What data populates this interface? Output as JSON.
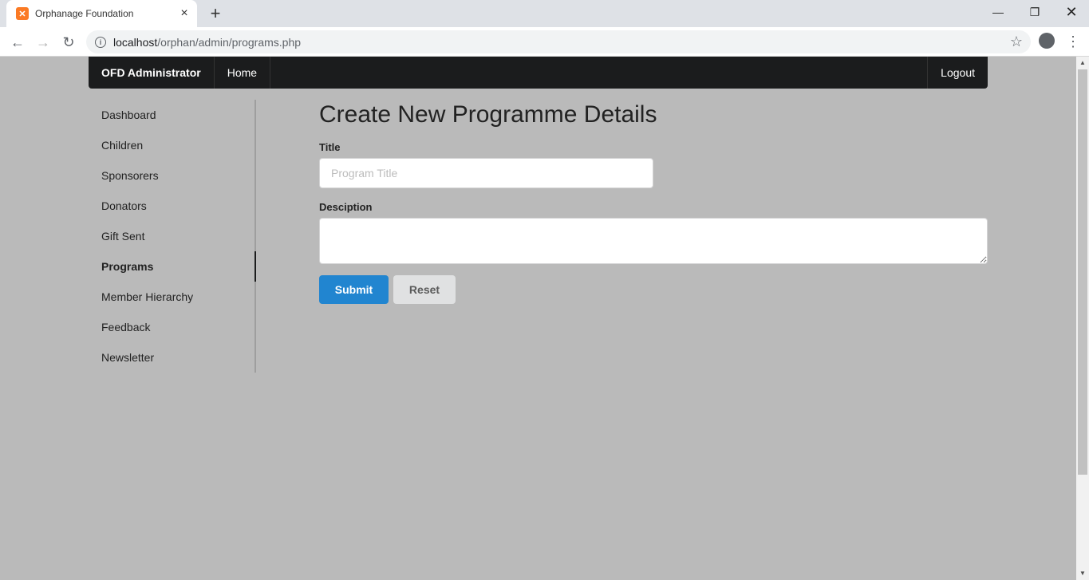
{
  "browser": {
    "tab_title": "Orphanage Foundation",
    "tab_favicon": "xampp-icon",
    "url_host": "localhost",
    "url_path": "/orphan/admin/programs.php"
  },
  "navbar": {
    "brand": "OFD Administrator",
    "home": "Home",
    "logout": "Logout"
  },
  "sidebar": {
    "items": [
      {
        "label": "Dashboard"
      },
      {
        "label": "Children"
      },
      {
        "label": "Sponsorers"
      },
      {
        "label": "Donators"
      },
      {
        "label": "Gift Sent"
      },
      {
        "label": "Programs",
        "active": true
      },
      {
        "label": "Member Hierarchy"
      },
      {
        "label": "Feedback"
      },
      {
        "label": "Newsletter"
      }
    ]
  },
  "form": {
    "heading": "Create New Programme Details",
    "title_label": "Title",
    "title_placeholder": "Program Title",
    "title_value": "",
    "description_label": "Desciption",
    "description_value": "",
    "submit_label": "Submit",
    "reset_label": "Reset"
  },
  "colors": {
    "page_background": "#bababa",
    "navbar": "#1b1c1d",
    "primary_button": "#2185d0",
    "secondary_button": "#e0e1e2"
  }
}
